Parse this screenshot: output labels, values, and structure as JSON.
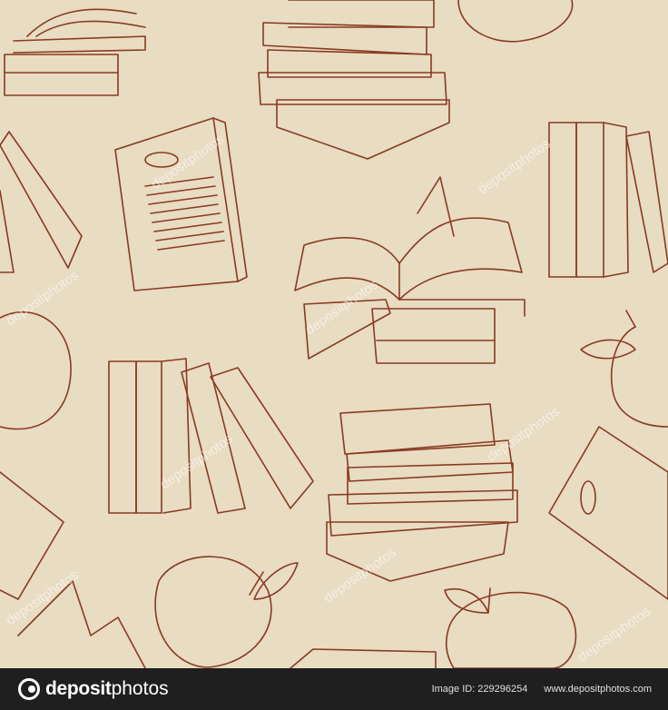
{
  "image": {
    "subject": "hand-drawn sepia sketch pattern of stacked books, open books and apples",
    "stroke_color": "#8a3a22",
    "background_color": "#e8dcc3"
  },
  "watermark": {
    "text": "depositphotos"
  },
  "footer": {
    "logo_bold": "deposit",
    "logo_rest": "photos",
    "image_id_label": "Image ID: 229296254",
    "site_url": "www.depositphotos.com",
    "background_color": "#1f1f1f"
  }
}
